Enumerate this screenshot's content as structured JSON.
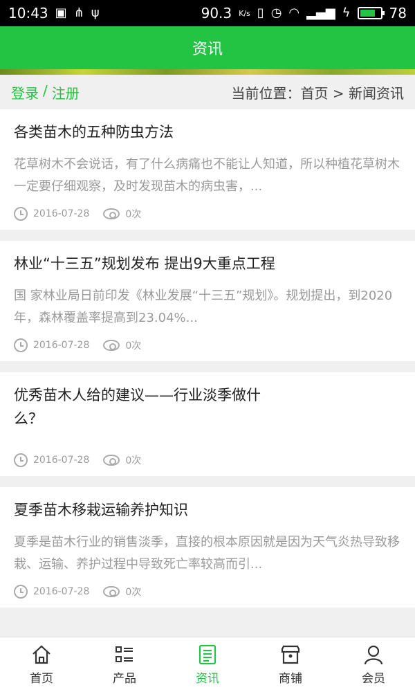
{
  "status": {
    "time": "10:43",
    "net_speed": "90.3",
    "speed_unit": "K/s",
    "battery": "78",
    "battery_fraction": 0.78
  },
  "header": {
    "title": "资讯"
  },
  "crumbs": {
    "login": "登录",
    "sep": "/",
    "register": "注册",
    "location": "当前位置：首页 > 新闻资讯"
  },
  "articles": [
    {
      "title": "各类苗木的五种防虫方法",
      "summary": "花草树木不会说话，有了什么病痛也不能让人知道，所以种植花草树木一定要仔细观察，及时发现苗木的病虫害，...",
      "date": "2016-07-28",
      "views": "0次"
    },
    {
      "title": "林业“十三五”规划发布 提出9大重点工程",
      "summary": "国 家林业局日前印发《林业发展“十三五”规划》。规划提出，到2020年，森林覆盖率提高到23.04%...",
      "date": "2016-07-28",
      "views": "0次"
    },
    {
      "title": "优秀苗木人给的建议——行业淡季做什么？",
      "summary": "",
      "date": "2016-07-28",
      "views": "0次"
    },
    {
      "title": "夏季苗木移栽运输养护知识",
      "summary": "夏季是苗木行业的销售淡季，直接的根本原因就是因为天气炎热导致移栽、运输、养护过程中导致死亡率较高而引...",
      "date": "2016-07-28",
      "views": "0次"
    }
  ],
  "tabs": [
    {
      "label": "首页",
      "icon": "home-icon"
    },
    {
      "label": "产品",
      "icon": "list-icon"
    },
    {
      "label": "资讯",
      "icon": "news-icon"
    },
    {
      "label": "商铺",
      "icon": "shop-icon"
    },
    {
      "label": "会员",
      "icon": "user-icon"
    }
  ],
  "colors": {
    "brand": "#23c343"
  }
}
